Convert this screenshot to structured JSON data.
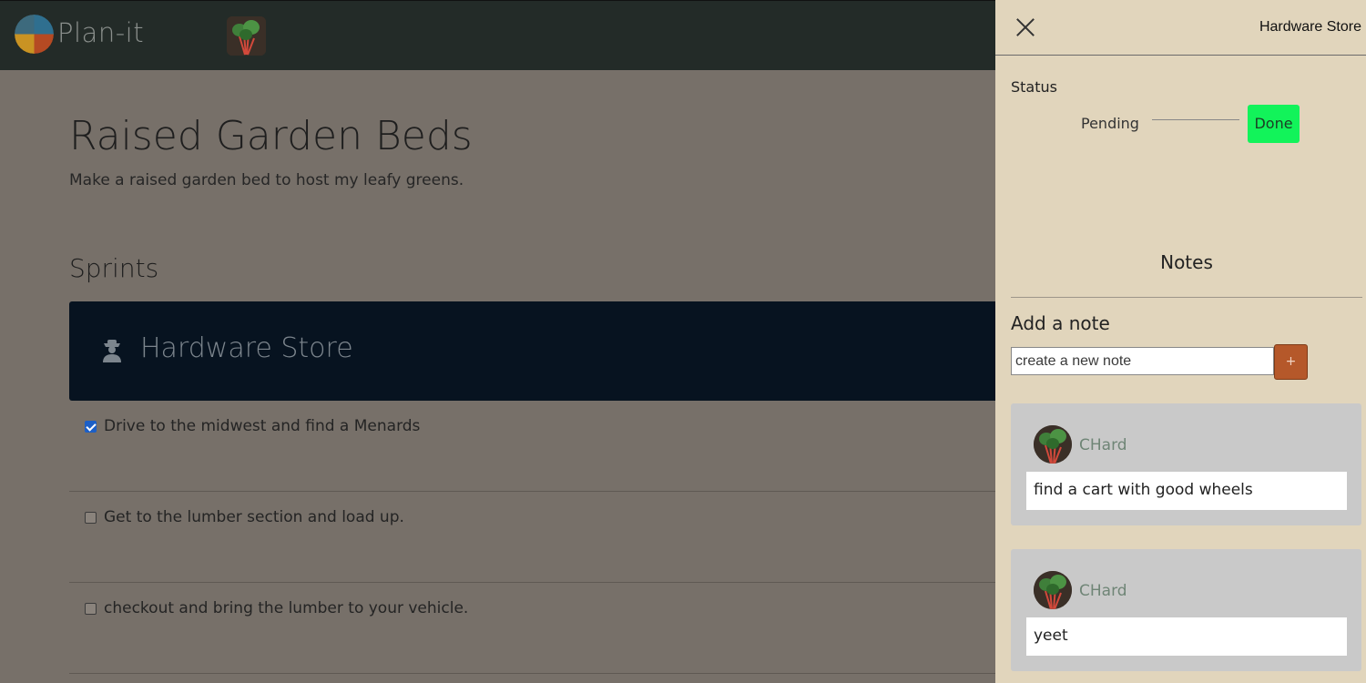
{
  "app": {
    "name": "Plan-it",
    "logo_icon": "plan-it-logo-icon",
    "user_avatar": "chard-avatar"
  },
  "project": {
    "title": "Raised Garden Beds",
    "description": "Make a raised garden bed to host my leafy greens."
  },
  "sprints": {
    "heading": "Sprints",
    "items": [
      {
        "title": "Hardware Store",
        "icon": "person-hat-icon",
        "tasks": [
          {
            "label": "Drive to the midwest and find a Menards",
            "checked": true
          },
          {
            "label": "Get to the lumber section and load up.",
            "checked": false
          },
          {
            "label": "checkout and bring the lumber to your vehicle.",
            "checked": false
          }
        ]
      }
    ]
  },
  "drawer": {
    "title": "Hardware Store",
    "close_icon": "close-icon",
    "status": {
      "label": "Status",
      "options": [
        "Pending",
        "Done"
      ],
      "selected": "Done",
      "selected_color": "#12f35a"
    },
    "notes": {
      "heading": "Notes",
      "add_label": "Add a note",
      "input_placeholder": "create a new note",
      "input_value": "",
      "add_button_label": "+",
      "add_button_color": "#b5582a",
      "items": [
        {
          "author": "CHard",
          "text": "find a cart with good wheels"
        },
        {
          "author": "CHard",
          "text": "yeet"
        }
      ]
    }
  },
  "colors": {
    "navbar": "#232b28",
    "overlay_bg": "#777069",
    "sprint_card": "#071320",
    "drawer_bg": "#e1d5bc"
  }
}
